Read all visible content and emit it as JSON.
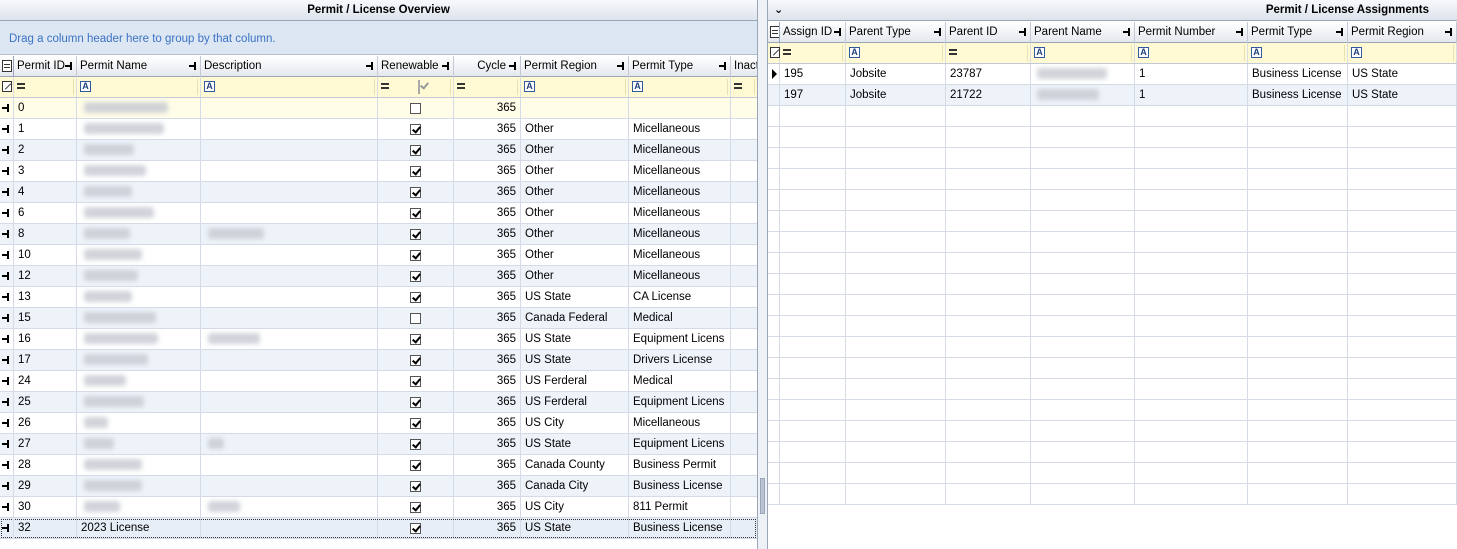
{
  "left_panel": {
    "title": "Permit / License Overview",
    "group_hint": "Drag a column header here to group by that column.",
    "columns": [
      "Permit ID",
      "Permit Name",
      "Description",
      "Renewable",
      "Cycle",
      "Permit Region",
      "Permit Type",
      "Inact"
    ],
    "rows": [
      {
        "id": "0",
        "name": "",
        "desc": "",
        "renewable": false,
        "cycle": "365",
        "region": "",
        "type": ""
      },
      {
        "id": "1",
        "name": "",
        "desc": "",
        "renewable": true,
        "cycle": "365",
        "region": "Other",
        "type": "Micellaneous"
      },
      {
        "id": "2",
        "name": "",
        "desc": "",
        "renewable": true,
        "cycle": "365",
        "region": "Other",
        "type": "Micellaneous"
      },
      {
        "id": "3",
        "name": "",
        "desc": "",
        "renewable": true,
        "cycle": "365",
        "region": "Other",
        "type": "Micellaneous"
      },
      {
        "id": "4",
        "name": "",
        "desc": "",
        "renewable": true,
        "cycle": "365",
        "region": "Other",
        "type": "Micellaneous"
      },
      {
        "id": "6",
        "name": "",
        "desc": "",
        "renewable": true,
        "cycle": "365",
        "region": "Other",
        "type": "Micellaneous"
      },
      {
        "id": "8",
        "name": "",
        "desc": "",
        "renewable": true,
        "cycle": "365",
        "region": "Other",
        "type": "Micellaneous"
      },
      {
        "id": "10",
        "name": "",
        "desc": "",
        "renewable": true,
        "cycle": "365",
        "region": "Other",
        "type": "Micellaneous"
      },
      {
        "id": "12",
        "name": "",
        "desc": "",
        "renewable": true,
        "cycle": "365",
        "region": "Other",
        "type": "Micellaneous"
      },
      {
        "id": "13",
        "name": "",
        "desc": "",
        "renewable": true,
        "cycle": "365",
        "region": "US State",
        "type": "CA License"
      },
      {
        "id": "15",
        "name": "",
        "desc": "",
        "renewable": false,
        "cycle": "365",
        "region": "Canada Federal",
        "type": "Medical"
      },
      {
        "id": "16",
        "name": "",
        "desc": "",
        "renewable": true,
        "cycle": "365",
        "region": "US State",
        "type": "Equipment Licens"
      },
      {
        "id": "17",
        "name": "",
        "desc": "",
        "renewable": true,
        "cycle": "365",
        "region": "US State",
        "type": "Drivers License"
      },
      {
        "id": "24",
        "name": "",
        "desc": "",
        "renewable": true,
        "cycle": "365",
        "region": "US Ferderal",
        "type": "Medical"
      },
      {
        "id": "25",
        "name": "",
        "desc": "",
        "renewable": true,
        "cycle": "365",
        "region": "US Ferderal",
        "type": "Equipment Licens"
      },
      {
        "id": "26",
        "name": "",
        "desc": "",
        "renewable": true,
        "cycle": "365",
        "region": "US City",
        "type": "Micellaneous"
      },
      {
        "id": "27",
        "name": "",
        "desc": "",
        "renewable": true,
        "cycle": "365",
        "region": "US State",
        "type": "Equipment Licens"
      },
      {
        "id": "28",
        "name": "",
        "desc": "",
        "renewable": true,
        "cycle": "365",
        "region": "Canada County",
        "type": "Business Permit"
      },
      {
        "id": "29",
        "name": "",
        "desc": "",
        "renewable": true,
        "cycle": "365",
        "region": "Canada City",
        "type": "Business License"
      },
      {
        "id": "30",
        "name": "",
        "desc": "",
        "renewable": true,
        "cycle": "365",
        "region": "US City",
        "type": "811 Permit"
      },
      {
        "id": "32",
        "name": "2023 License",
        "desc": "",
        "renewable": true,
        "cycle": "365",
        "region": "US State",
        "type": "Business License"
      }
    ]
  },
  "right_panel": {
    "title": "Permit / License Assignments",
    "columns": [
      "Assign ID",
      "Parent Type",
      "Parent ID",
      "Parent Name",
      "Permit Number",
      "Permit Type",
      "Permit Region"
    ],
    "rows": [
      {
        "assign_id": "195",
        "parent_type": "Jobsite",
        "parent_id": "23787",
        "parent_name": "",
        "permit_number": "1",
        "permit_type": "Business License",
        "permit_region": "US State"
      },
      {
        "assign_id": "197",
        "parent_type": "Jobsite",
        "parent_id": "21722",
        "parent_name": "",
        "permit_number": "1",
        "permit_type": "Business License",
        "permit_region": "US State"
      }
    ]
  }
}
